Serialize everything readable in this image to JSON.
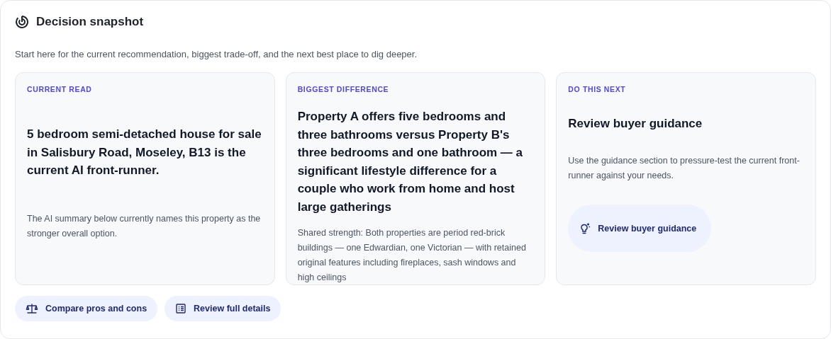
{
  "panel": {
    "title": "Decision snapshot",
    "intro": "Start here for the current recommendation, biggest trade-off, and the next best place to dig deeper."
  },
  "cards": [
    {
      "label": "CURRENT READ",
      "headline": "5 bedroom semi-detached house for sale in Salisbury Road, Moseley, B13 is the current AI front-runner.",
      "note": "The AI summary below currently names this property as the stronger overall option."
    },
    {
      "label": "BIGGEST DIFFERENCE",
      "headline": "Property A offers five bedrooms and three bathrooms versus Property B's three bedrooms and one bathroom — a significant lifestyle difference for a couple who work from home and host large gatherings",
      "note": "Shared strength: Both properties are period red-brick buildings — one Edwardian, one Victorian — with retained original features including fireplaces, sash windows and high ceilings"
    },
    {
      "label": "DO THIS NEXT",
      "headline": "Review buyer guidance",
      "note": "Use the guidance section to pressure-test the current front-runner against your needs.",
      "button": "Review buyer guidance"
    }
  ],
  "actions": [
    "Compare pros and cons",
    "Review full details"
  ]
}
